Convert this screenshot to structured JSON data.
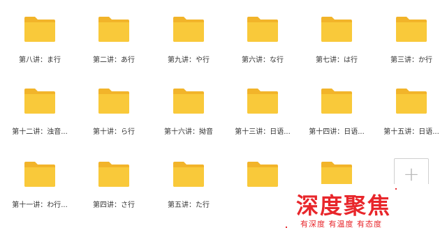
{
  "folders": [
    {
      "label": "第八讲：ま行"
    },
    {
      "label": "第二讲：あ行"
    },
    {
      "label": "第九讲：や行"
    },
    {
      "label": "第六讲：な行"
    },
    {
      "label": "第七讲：は行"
    },
    {
      "label": "第三讲：か行"
    },
    {
      "label": "第十二讲：浊音..."
    },
    {
      "label": "第十讲：ら行"
    },
    {
      "label": "第十六讲：拗音"
    },
    {
      "label": "第十三讲：日语..."
    },
    {
      "label": "第十四讲：日语..."
    },
    {
      "label": "第十五讲：日语..."
    },
    {
      "label": "第十一讲：わ行..."
    },
    {
      "label": "第四讲：さ行"
    },
    {
      "label": "第五讲：た行"
    },
    {
      "label": ""
    },
    {
      "label": ""
    }
  ],
  "add_button": {
    "symbol": "+"
  },
  "watermark": {
    "title": "深度聚焦",
    "subtitle": "有深度 有温度 有态度"
  },
  "colors": {
    "folder_front": "#F9C93A",
    "folder_back": "#F2B42A",
    "watermark_red": "#E8262B"
  }
}
